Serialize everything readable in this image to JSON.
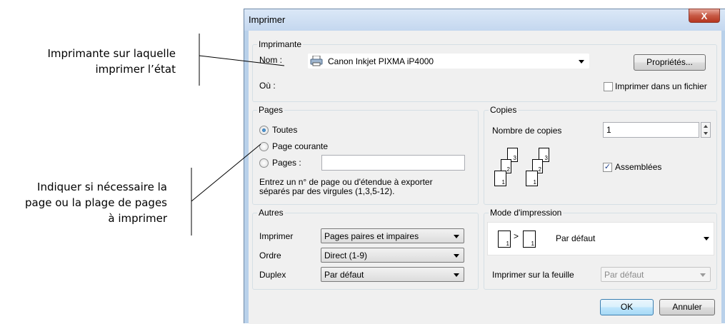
{
  "annotations": {
    "top": [
      "Imprimante sur laquelle",
      "imprimer l’état"
    ],
    "middle": [
      "Indiquer si nécessaire la",
      "page ou la plage de pages",
      "à imprimer"
    ]
  },
  "dialog": {
    "title": "Imprimer",
    "close_symbol": "X",
    "printer": {
      "group_label": "Imprimante",
      "name_label": "Nom :",
      "name_value": "Canon Inkjet PIXMA iP4000",
      "printer_icon": "printer-icon",
      "properties_button": "Propriétés...",
      "where_label": "Où :",
      "print_to_file_label": "Imprimer dans un fichier",
      "print_to_file_checked": false
    },
    "pages": {
      "group_label": "Pages",
      "all": "Toutes",
      "current": "Page courante",
      "range": "Pages :",
      "selected": "all",
      "hint_line1": "Entrez un n° de page ou d'étendue à exporter",
      "hint_line2": "séparés par des virgules (1,3,5-12)."
    },
    "copies": {
      "group_label": "Copies",
      "count_label": "Nombre de copies",
      "count_value": "1",
      "collate_label": "Assemblées",
      "collate_checked": true,
      "page_numbers": [
        "1",
        "2",
        "3"
      ]
    },
    "others": {
      "group_label": "Autres",
      "print_label": "Imprimer",
      "print_value": "Pages paires et impaires",
      "order_label": "Ordre",
      "order_value": "Direct (1-9)",
      "duplex_label": "Duplex",
      "duplex_value": "Par défaut"
    },
    "mode": {
      "group_label": "Mode d'impression",
      "value": "Par défaut",
      "sheet_label": "Imprimer sur la feuille",
      "sheet_value": "Par défaut",
      "page_numbers": [
        "1",
        "1"
      ]
    },
    "ok_button": "OK",
    "cancel_button": "Annuler"
  }
}
